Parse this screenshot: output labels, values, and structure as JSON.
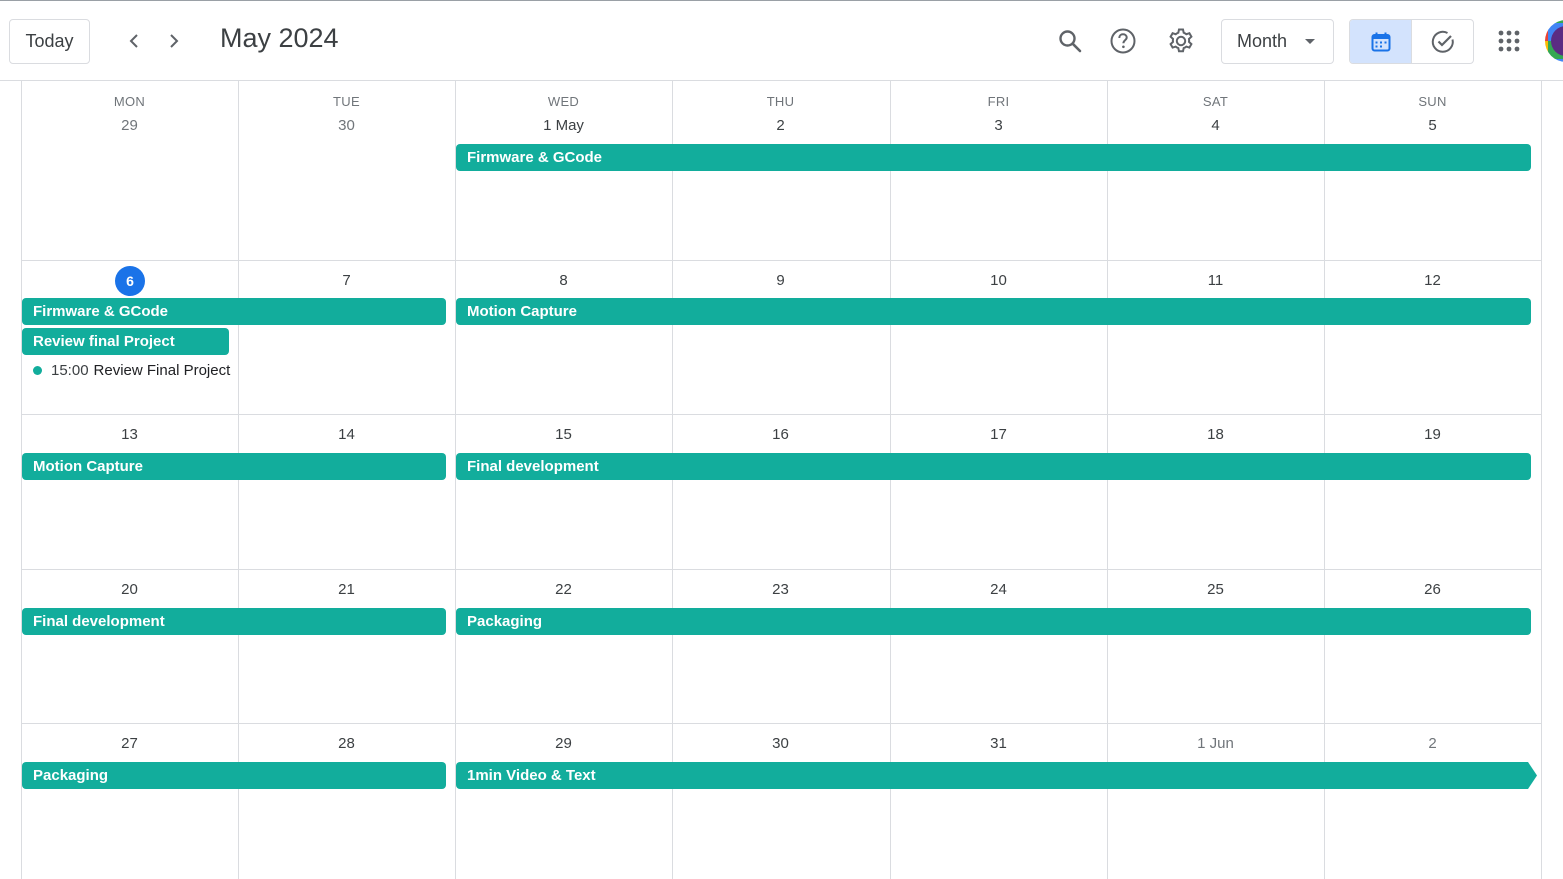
{
  "header": {
    "today_label": "Today",
    "title": "May 2024",
    "view_select": "Month",
    "icons": {
      "prev": "chevron-left-icon",
      "next": "chevron-right-icon",
      "search": "search-icon",
      "help": "help-icon",
      "settings": "gear-icon",
      "calendar_view": "calendar-icon",
      "tasks_view": "check-circle-icon",
      "apps": "apps-grid-icon"
    },
    "accent": "#1a73e8",
    "event_color": "#12ad9c"
  },
  "calendar": {
    "weekdays": [
      "MON",
      "TUE",
      "WED",
      "THU",
      "FRI",
      "SAT",
      "SUN"
    ],
    "weeks": [
      {
        "days": [
          "29",
          "30",
          "1 May",
          "2",
          "3",
          "4",
          "5"
        ]
      },
      {
        "days": [
          "6",
          "7",
          "8",
          "9",
          "10",
          "11",
          "12"
        ]
      },
      {
        "days": [
          "13",
          "14",
          "15",
          "16",
          "17",
          "18",
          "19"
        ]
      },
      {
        "days": [
          "20",
          "21",
          "22",
          "23",
          "24",
          "25",
          "26"
        ]
      },
      {
        "days": [
          "27",
          "28",
          "29",
          "30",
          "31",
          "1 Jun",
          "2"
        ]
      }
    ],
    "today": "6",
    "events": [
      {
        "title": "Firmware & GCode"
      },
      {
        "title": "Firmware & GCode"
      },
      {
        "title": "Review final Project"
      },
      {
        "title": "Motion Capture"
      },
      {
        "title": "Motion Capture"
      },
      {
        "title": "Final development"
      },
      {
        "title": "Final development"
      },
      {
        "title": "Packaging"
      },
      {
        "title": "Packaging"
      },
      {
        "title": "1min Video & Text"
      }
    ],
    "timed_event": {
      "time": "15:00",
      "title": "Review Final Project"
    }
  }
}
